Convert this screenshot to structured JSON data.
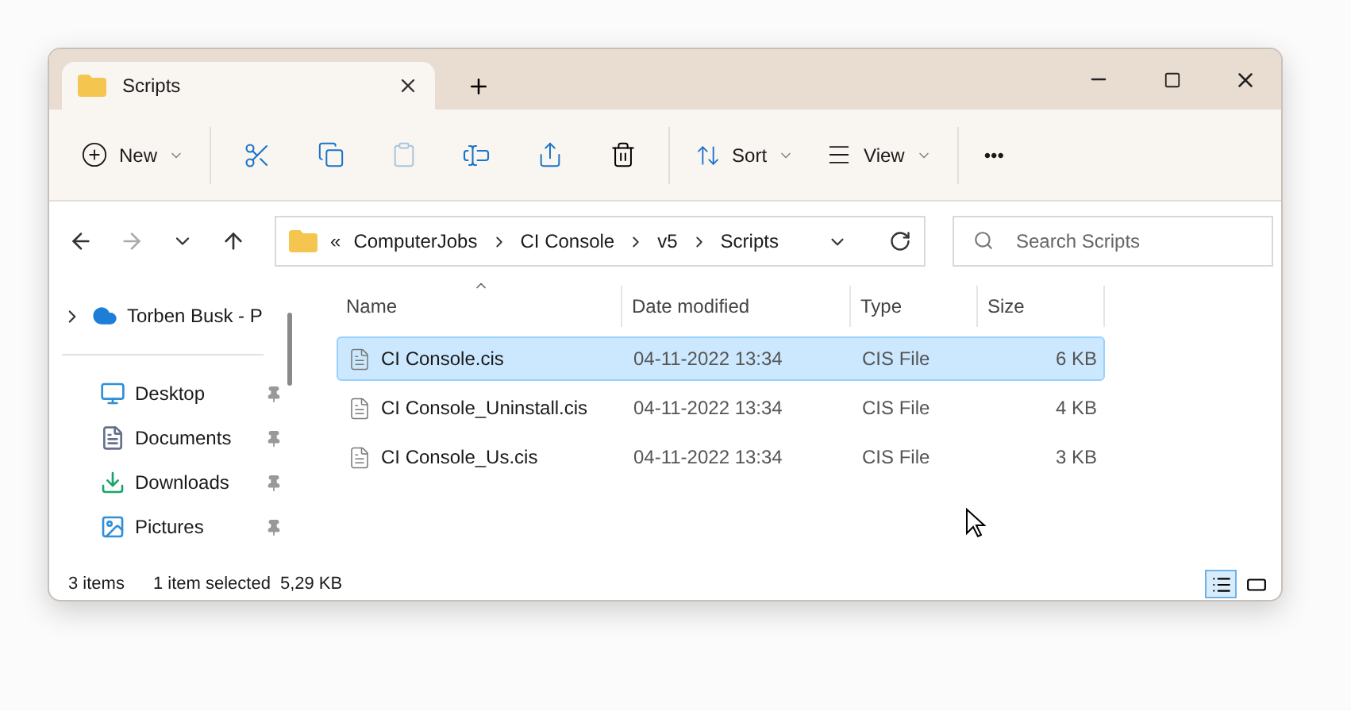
{
  "tabs": [
    {
      "label": "Scripts",
      "selected": true
    }
  ],
  "toolbar": {
    "new": "New",
    "sort": "Sort",
    "view": "View",
    "more": "•••"
  },
  "address": {
    "overflow": "«",
    "crumbs": [
      "ComputerJobs",
      "CI Console",
      "v5",
      "Scripts"
    ],
    "search_placeholder": "Search Scripts"
  },
  "sidebar": {
    "items": [
      {
        "label": "Torben Busk - P",
        "kind": "cloud",
        "pinned": false
      },
      {
        "label": "Desktop",
        "kind": "desktop",
        "pinned": true
      },
      {
        "label": "Documents",
        "kind": "documents",
        "pinned": true
      },
      {
        "label": "Downloads",
        "kind": "downloads",
        "pinned": true
      },
      {
        "label": "Pictures",
        "kind": "pictures",
        "pinned": true
      }
    ]
  },
  "table": {
    "columns": [
      "Name",
      "Date modified",
      "Type",
      "Size"
    ],
    "rows": [
      {
        "name": "CI Console.cis",
        "date": "04-11-2022 13:34",
        "type": "CIS File",
        "size": "6 KB",
        "selected": true
      },
      {
        "name": "CI Console_Uninstall.cis",
        "date": "04-11-2022 13:34",
        "type": "CIS File",
        "size": "4 KB",
        "selected": false
      },
      {
        "name": "CI Console_Us.cis",
        "date": "04-11-2022 13:34",
        "type": "CIS File",
        "size": "3 KB",
        "selected": false
      }
    ]
  },
  "status_bar": {
    "count": "3 items",
    "selection": "1 item selected",
    "size": "5,29 KB"
  },
  "views": [
    {
      "kind": "details",
      "selected": true
    },
    {
      "kind": "tiles",
      "selected": false
    }
  ]
}
